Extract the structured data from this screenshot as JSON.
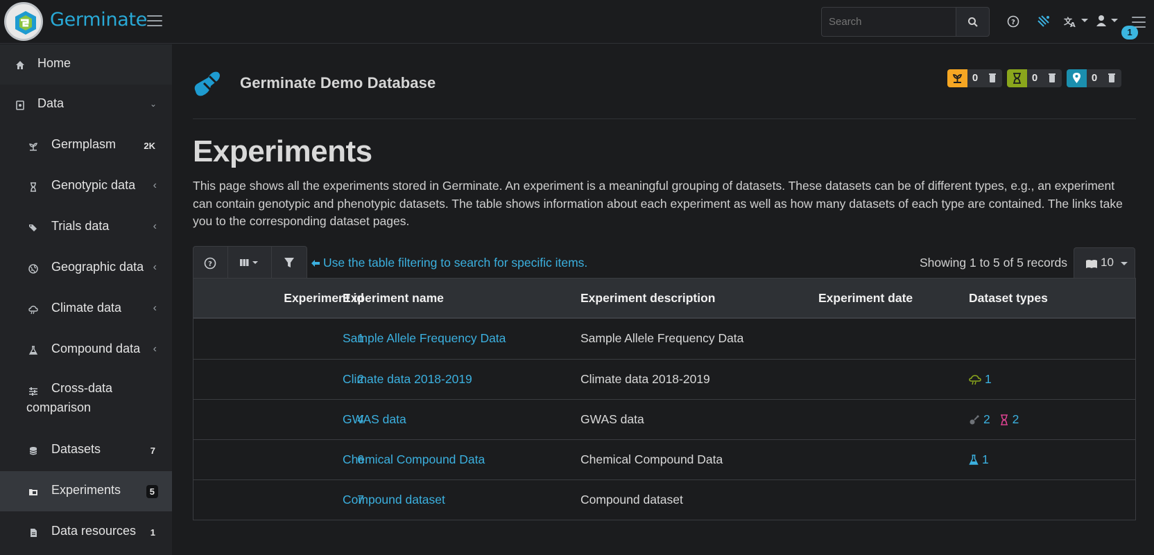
{
  "header": {
    "brand": "Germinate",
    "search_placeholder": "Search",
    "notification_count": "1"
  },
  "sidebar": {
    "items": [
      {
        "label": "Home",
        "icon": "home-icon"
      },
      {
        "label": "Data",
        "icon": "data-icon"
      },
      {
        "label": "Germplasm",
        "badge": "2K",
        "icon": "germplasm-icon"
      },
      {
        "label": "Genotypic data",
        "icon": "hourglass-icon"
      },
      {
        "label": "Trials data",
        "icon": "tags-icon"
      },
      {
        "label": "Geographic data",
        "icon": "globe-icon"
      },
      {
        "label": "Climate data",
        "icon": "weather-icon"
      },
      {
        "label": "Compound data",
        "icon": "flask-icon"
      },
      {
        "label": "Cross-data comparison",
        "icon": "compare-icon"
      },
      {
        "label": "Datasets",
        "badge": "7",
        "icon": "database-icon"
      },
      {
        "label": "Experiments",
        "badge": "5",
        "icon": "folder-icon"
      },
      {
        "label": "Data resources",
        "badge": "1",
        "icon": "file-icon"
      }
    ]
  },
  "main": {
    "db_title": "Germinate Demo Database",
    "marked": {
      "germplasm": "0",
      "markers": "0",
      "locations": "0"
    },
    "title": "Experiments",
    "description": "This page shows all the experiments stored in Germinate. An experiment is a meaningful grouping of datasets. These datasets can be of different types, e.g., an experiment can contain genotypic and phenotypic datasets. The table shows information about each experiment as well as how many datasets of each type are contained. The links take you to the corresponding dataset pages.",
    "filter_hint": "Use the table filtering to search for specific items.",
    "record_count": "Showing 1 to 5 of 5 records",
    "per_page": "10"
  },
  "table": {
    "columns": [
      "Experiment id",
      "Experiment name",
      "Experiment description",
      "Experiment date",
      "Dataset types"
    ],
    "rows": [
      {
        "id": "1",
        "name": "Sample Allele Frequency Data",
        "description": "Sample Allele Frequency Data",
        "date": "",
        "types": []
      },
      {
        "id": "2",
        "name": "Climate data 2018-2019",
        "description": "Climate data 2018-2019",
        "date": "",
        "types": [
          {
            "icon": "weather-icon",
            "count": "1"
          }
        ]
      },
      {
        "id": "4",
        "name": "GWAS data",
        "description": "GWAS data",
        "date": "",
        "types": [
          {
            "icon": "gwas-icon",
            "count": "2"
          },
          {
            "icon": "hourglass-icon",
            "count": "2"
          }
        ]
      },
      {
        "id": "6",
        "name": "Chemical Compound Data",
        "description": "Chemical Compound Data",
        "date": "",
        "types": [
          {
            "icon": "flask-icon",
            "count": "1"
          }
        ]
      },
      {
        "id": "7",
        "name": "Compound dataset",
        "description": "Compound dataset",
        "date": "",
        "types": []
      }
    ]
  },
  "colors": {
    "accent": "#3bb0df",
    "germplasm_mark": "#f5a623",
    "marker_mark": "#8aa61c",
    "location_mark": "#1b8fae",
    "climate_type": "#8aa61c",
    "genotype_type": "#d9418f",
    "compound_type": "#3bb0df"
  }
}
